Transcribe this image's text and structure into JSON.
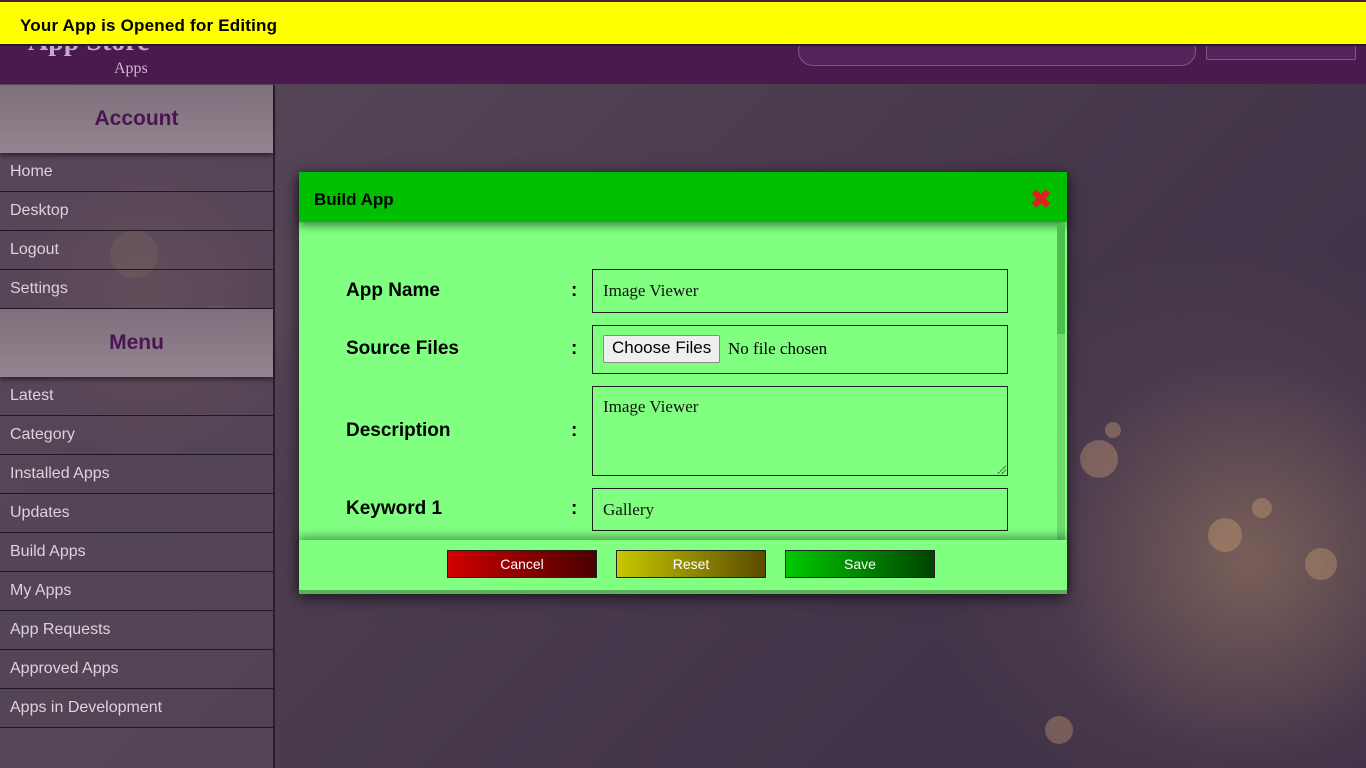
{
  "notice": {
    "text": "Your App is Opened for Editing"
  },
  "header": {
    "brand": "App Store",
    "subtitle": "Apps"
  },
  "sidebar": {
    "account": {
      "title": "Account",
      "items": [
        "Home",
        "Desktop",
        "Logout",
        "Settings"
      ]
    },
    "menu": {
      "title": "Menu",
      "items": [
        "Latest",
        "Category",
        "Installed Apps",
        "Updates",
        "Build Apps",
        "My Apps",
        "App Requests",
        "Approved Apps",
        "Apps in Development"
      ]
    }
  },
  "modal": {
    "title": "Build App",
    "close_icon": "close-icon",
    "fields": {
      "app_name": {
        "label": "App Name",
        "value": "Image Viewer"
      },
      "source_files": {
        "label": "Source Files",
        "button": "Choose Files",
        "status": "No file chosen"
      },
      "description": {
        "label": "Description",
        "value": "Image Viewer"
      },
      "keyword1": {
        "label": "Keyword 1",
        "value": "Gallery"
      }
    },
    "colon": ":",
    "buttons": {
      "cancel": "Cancel",
      "reset": "Reset",
      "save": "Save"
    }
  }
}
